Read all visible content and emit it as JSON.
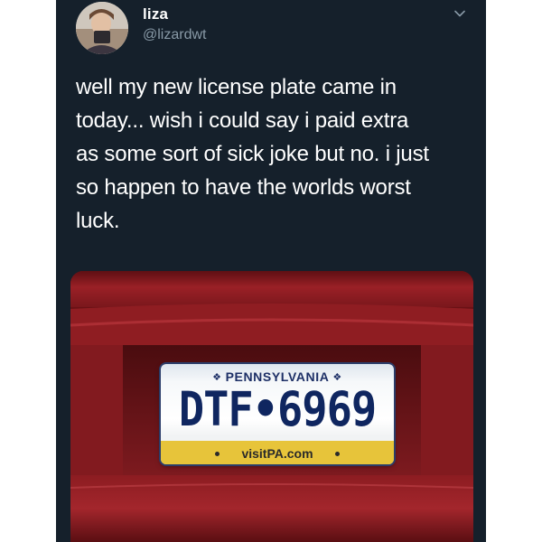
{
  "user": {
    "name": "liza",
    "handle": "@lizardwt"
  },
  "tweet": {
    "lines": [
      "well my new license plate came in",
      "today... wish i could say i paid extra",
      "as some sort of sick joke but no. i just",
      "so happen to have the worlds worst",
      "luck."
    ]
  },
  "plate": {
    "state": "PENNSYLVANIA",
    "number": "DTF•6969",
    "url": "visitPA.com"
  },
  "icons": {
    "menu": "chevron-down-icon",
    "state_marks": "keystone-icon"
  },
  "colors": {
    "background": "#15202b",
    "text": "#ffffff",
    "muted": "#8899a6",
    "car": "#8e1a1f",
    "plate_blue": "#1d2f66",
    "plate_yellow": "#e7c43a"
  }
}
